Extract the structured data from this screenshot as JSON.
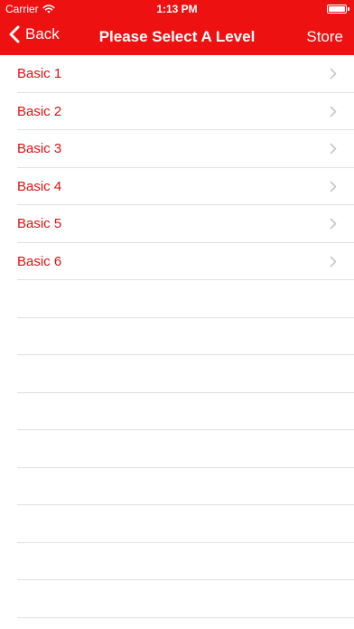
{
  "status_bar": {
    "carrier": "Carrier",
    "time": "1:13 PM",
    "wifi_icon": "wifi-icon",
    "battery_icon": "battery-icon"
  },
  "nav": {
    "back_label": "Back",
    "title": "Please Select A Level",
    "store_label": "Store",
    "back_icon": "chevron-left-icon"
  },
  "levels": [
    {
      "label": "Basic 1"
    },
    {
      "label": "Basic 2"
    },
    {
      "label": "Basic 3"
    },
    {
      "label": "Basic 4"
    },
    {
      "label": "Basic 5"
    },
    {
      "label": "Basic 6"
    }
  ],
  "colors": {
    "accent": "#ee1111",
    "label_red": "#dd1111",
    "separator": "#e0e0e0",
    "chevron": "#c7c7cc"
  }
}
